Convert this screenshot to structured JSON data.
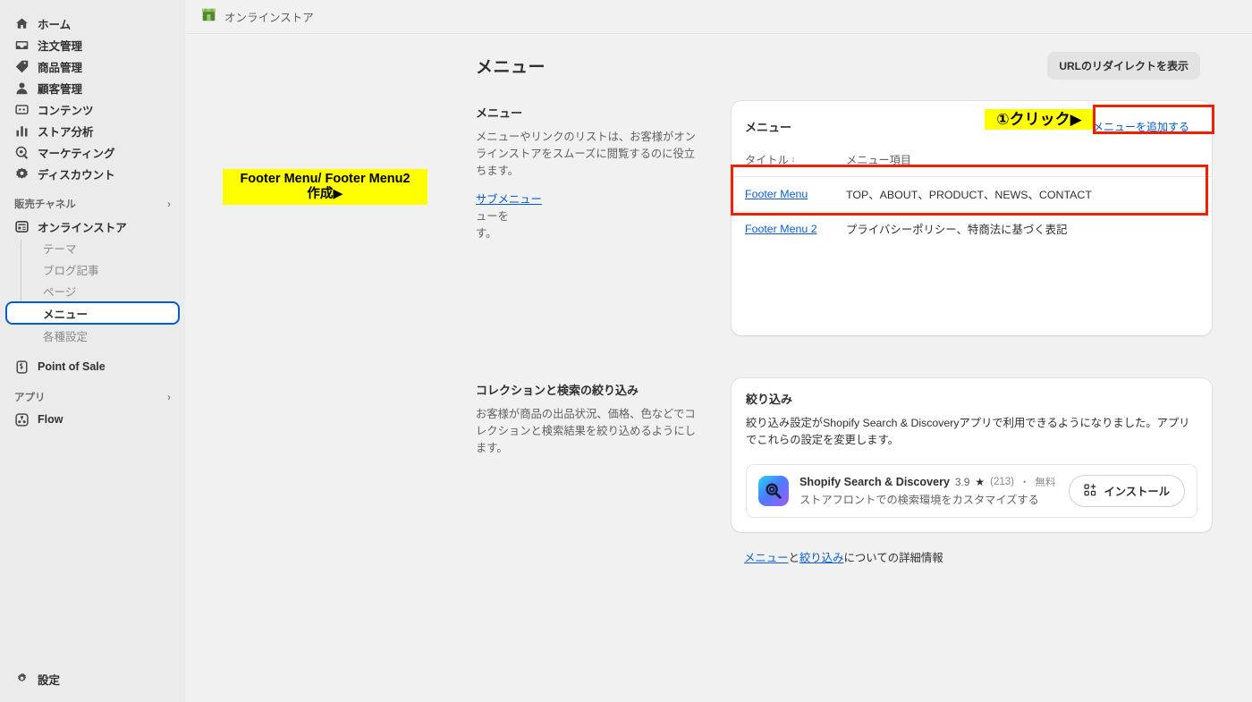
{
  "sidebar": {
    "main_items": [
      {
        "label": "ホーム",
        "icon": "home-icon"
      },
      {
        "label": "注文管理",
        "icon": "orders-inbox-icon"
      },
      {
        "label": "商品管理",
        "icon": "product-tag-icon"
      },
      {
        "label": "顧客管理",
        "icon": "customer-person-icon"
      },
      {
        "label": "コンテンツ",
        "icon": "content-icon"
      },
      {
        "label": "ストア分析",
        "icon": "analytics-bar-chart-icon"
      },
      {
        "label": "マーケティング",
        "icon": "marketing-target-icon"
      },
      {
        "label": "ディスカウント",
        "icon": "discount-icon"
      }
    ],
    "sales_channel_section": {
      "label": "販売チャネル",
      "chevron": "chevron-right-icon"
    },
    "online_store": {
      "label": "オンラインストア",
      "icon": "online-store-icon"
    },
    "online_store_children": [
      {
        "label": "テーマ",
        "active": false
      },
      {
        "label": "ブログ記事",
        "active": false
      },
      {
        "label": "ページ",
        "active": false
      },
      {
        "label": "メニュー",
        "active": true
      },
      {
        "label": "各種設定",
        "active": false
      }
    ],
    "point_of_sale": {
      "label": "Point of Sale",
      "icon": "pos-icon"
    },
    "apps_section": {
      "label": "アプリ",
      "chevron": "chevron-right-icon"
    },
    "flow": {
      "label": "Flow",
      "icon": "flow-icon"
    },
    "settings": {
      "label": "設定",
      "icon": "gear-icon"
    }
  },
  "topbar": {
    "store_name": "オンラインストア",
    "logo_icon": "shopify-storefront-icon"
  },
  "page": {
    "title": "メニュー",
    "url_redirect_button": "URLのリダイレクトを表示"
  },
  "menus_section": {
    "desc_title": "メニュー",
    "desc_body": "メニューやリンクのリストは、お客様がオンラインストアをスムーズに閲覧するのに役立ちます。",
    "desc_link": "サブメニュー",
    "desc_body2_a": "ューを",
    "desc_body2_b": "す。",
    "card_title": "メニュー",
    "add_menu_button": "メニューを追加する",
    "columns": [
      "タイトル",
      "メニュー項目"
    ],
    "sort_icon": "sort-arrows-icon",
    "rows": [
      {
        "title": "Footer Menu",
        "items": "TOP、ABOUT、PRODUCT、NEWS、CONTACT"
      },
      {
        "title": "Footer Menu 2",
        "items": "プライバシーポリシー、特商法に基づく表記"
      }
    ]
  },
  "filters_section": {
    "desc_title": "コレクションと検索の絞り込み",
    "desc_body": "お客様が商品の出品状況、価格、色などでコレクションと検索結果を絞り込めるようにします。",
    "card_title": "絞り込み",
    "card_body": "絞り込み設定がShopify Search & Discoveryアプリで利用できるようになりました。アプリでこれらの設定を変更します。",
    "app": {
      "icon": "search-magnifier-app-icon",
      "name": "Shopify Search & Discovery",
      "rating": "3.9",
      "star_icon": "star-icon",
      "review_count": "(213)",
      "separator": "・",
      "price": "無料",
      "subtitle": "ストアフロントでの検索環境をカスタマイズする",
      "install_button": "インストール",
      "install_icon": "app-grid-plus-icon"
    }
  },
  "footer": {
    "link1": "メニュー",
    "text_mid": "と",
    "link2": "絞り込み",
    "text_end": "についての詳細情報"
  },
  "annotations": {
    "click_badge": "①クリック▶",
    "create_note_line1": "Footer Menu/ Footer Menu2",
    "create_note_line2": "作成▶"
  },
  "colors": {
    "accent_blue": "#005bd3",
    "link_blue": "#0b5cd5",
    "annotation_red": "#ee2200",
    "annotation_yellow": "#ffff00",
    "sidebar_bg": "#ebebeb",
    "page_bg": "#f1f1f1",
    "shopify_green": "#5a8c3e"
  }
}
